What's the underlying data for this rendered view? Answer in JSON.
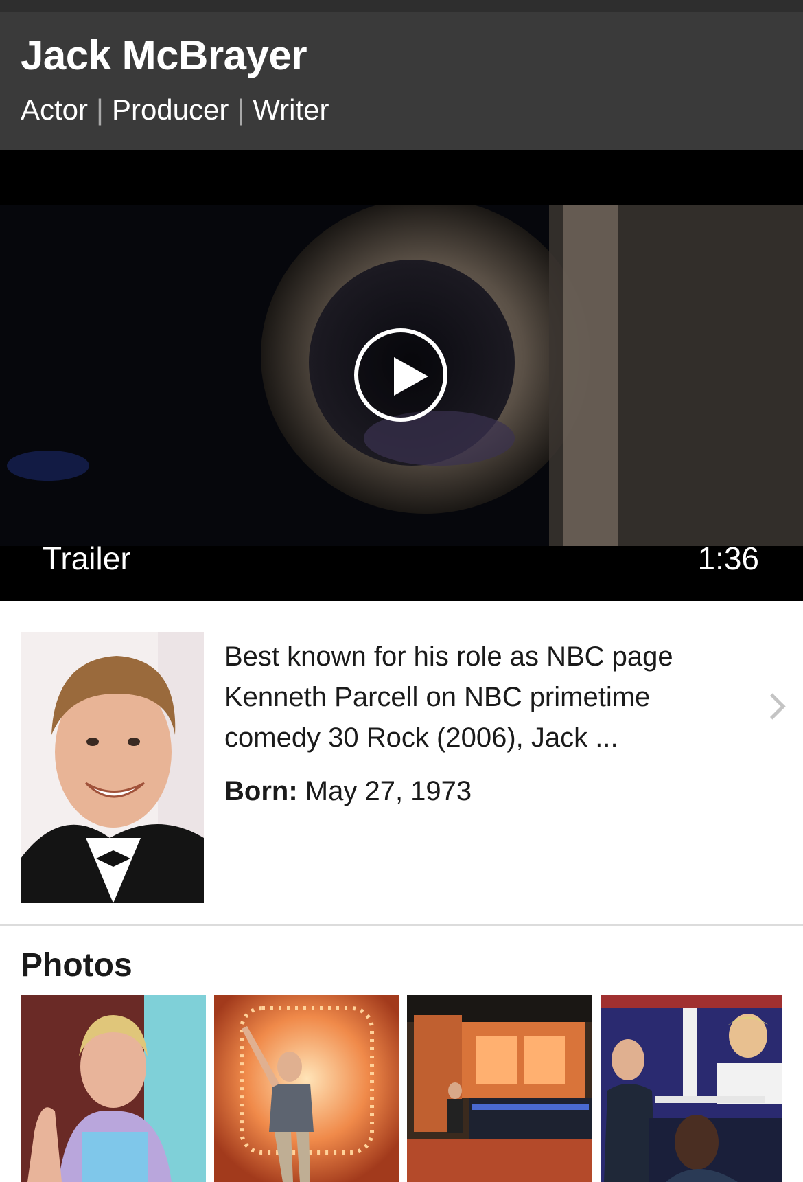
{
  "header": {
    "name": "Jack McBrayer",
    "roles": [
      "Actor",
      "Producer",
      "Writer"
    ]
  },
  "video": {
    "label": "Trailer",
    "duration": "1:36"
  },
  "bio": {
    "summary": "Best known for his role as NBC page Kenneth Parcell on NBC primetime comedy 30 Rock (2006), Jack ...",
    "born_label": "Born:",
    "born_value": "May 27, 1973"
  },
  "photos": {
    "title": "Photos",
    "items": [
      {
        "icon": "photo-cooking-show"
      },
      {
        "icon": "photo-stage-pointing"
      },
      {
        "icon": "photo-game-show-set"
      },
      {
        "icon": "photo-match-game-panel"
      }
    ]
  },
  "colors": {
    "header_bg": "#3a3a3a",
    "video_bg": "#000000",
    "divider": "#dcdcdc"
  }
}
